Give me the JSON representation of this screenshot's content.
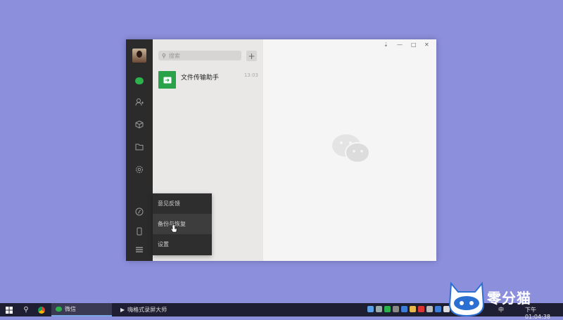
{
  "window": {
    "controls": {
      "pin": "⇣",
      "minimize": "—",
      "maximize": "□",
      "close": "✕"
    }
  },
  "sidebar": {
    "icons": [
      "chat-icon",
      "contacts-icon",
      "favorites-icon",
      "files-icon",
      "settings-plugin-icon",
      "miniprogram-icon",
      "phone-icon",
      "menu-icon"
    ]
  },
  "search": {
    "placeholder": "搜索"
  },
  "add_button": "+",
  "chats": [
    {
      "name": "文件传输助手",
      "time": "13:03"
    }
  ],
  "menu": {
    "items": [
      "意见反馈",
      "备份与恢复",
      "设置"
    ],
    "active_index": 1
  },
  "taskbar": {
    "apps": [
      {
        "label": "微信"
      },
      {
        "label": "嗨格式录屏大师"
      }
    ],
    "ime": "中",
    "clock": "下午 01:04:38"
  },
  "watermark_brand": "零分猫",
  "colors": {
    "desktop": "#8c8fdc",
    "wechat_green": "#2bb24c",
    "sidebar": "#2b2b2b",
    "taskbar": "#1f1f33"
  }
}
